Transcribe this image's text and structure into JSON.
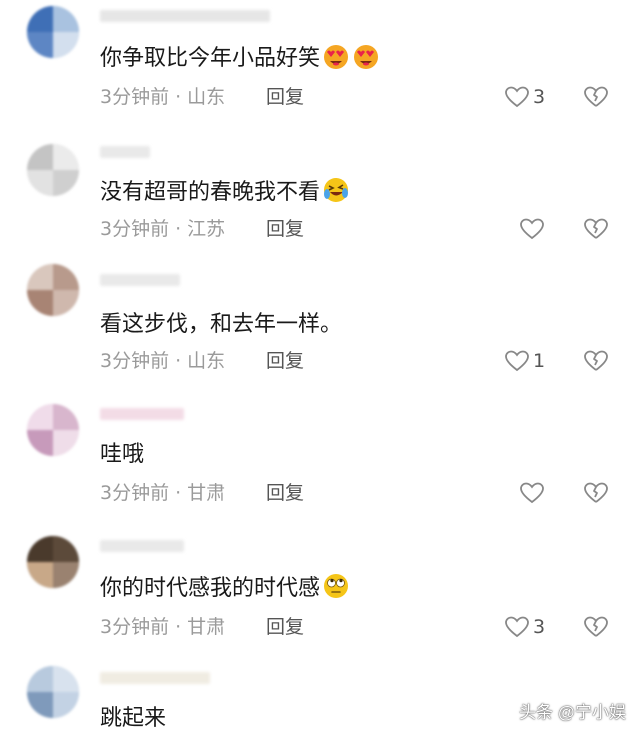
{
  "comments": [
    {
      "text": "你争取比今年小品好笑",
      "emoji": [
        "heart-eyes-emoji",
        "heart-eyes-emoji"
      ],
      "time": "3分钟前",
      "location": "山东",
      "reply_label": "回复",
      "likes": "3"
    },
    {
      "text": "没有超哥的春晚我不看",
      "emoji": [
        "laughing-tears-emoji"
      ],
      "time": "3分钟前",
      "location": "江苏",
      "reply_label": "回复",
      "likes": ""
    },
    {
      "text": "看这步伐，和去年一样。",
      "emoji": [],
      "time": "3分钟前",
      "location": "山东",
      "reply_label": "回复",
      "likes": "1"
    },
    {
      "text": "哇哦",
      "emoji": [],
      "time": "3分钟前",
      "location": "甘肃",
      "reply_label": "回复",
      "likes": ""
    },
    {
      "text": "你的时代感我的时代感",
      "emoji": [
        "rolling-eyes-emoji"
      ],
      "time": "3分钟前",
      "location": "甘肃",
      "reply_label": "回复",
      "likes": "3"
    },
    {
      "text": "跳起来",
      "emoji": [],
      "time": "",
      "location": "",
      "reply_label": "",
      "likes": ""
    }
  ],
  "separator": "·",
  "watermark": "头条 @宁小娱",
  "colors": {
    "meta": "#9a9a9a",
    "icon": "#888888"
  }
}
